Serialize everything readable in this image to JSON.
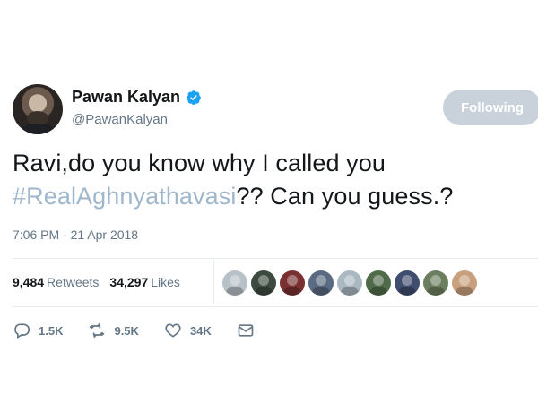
{
  "user": {
    "display_name": "Pawan Kalyan",
    "handle": "@PawanKalyan",
    "verified": true,
    "follow_button_label": "Following"
  },
  "tweet": {
    "text_part1": "Ravi,do you know why I called you",
    "hashtag": "#RealAghnyathavasi",
    "text_part2": "?? Can you guess.?",
    "timestamp": "7:06 PM - 21 Apr 2018"
  },
  "stats": {
    "retweets_count": "9,484",
    "retweets_label": "Retweets",
    "likes_count": "34,297",
    "likes_label": "Likes"
  },
  "liker_avatars": [
    {
      "color": "#b8c0c8"
    },
    {
      "color": "#3d4a3f"
    },
    {
      "color": "#7a3030"
    },
    {
      "color": "#5a6a82"
    },
    {
      "color": "#aab8c2"
    },
    {
      "color": "#4f6b4a"
    },
    {
      "color": "#3f4e6e"
    },
    {
      "color": "#6b7f5e"
    },
    {
      "color": "#c9a07e"
    }
  ],
  "actions": {
    "reply_count": "1.5K",
    "retweet_count": "9.5K",
    "like_count": "34K"
  },
  "colors": {
    "text_primary": "#14171a",
    "text_secondary": "#657786",
    "hashtag": "#9fb6cc",
    "verified_blue": "#1da1f2",
    "following_button": "#c9d2da"
  }
}
